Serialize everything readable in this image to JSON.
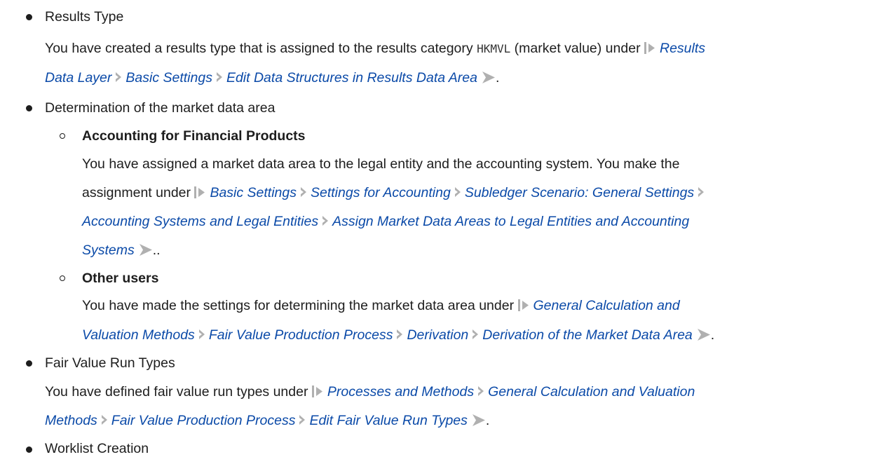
{
  "items": {
    "results_type": {
      "title": "Results Type",
      "text_1": "You have created a results type that is assigned to the results category ",
      "code": "HKMVL",
      "text_2": " (market value) under ",
      "path": [
        "Results",
        "Data Layer",
        "Basic Settings",
        "Edit Data Structures in Results Data Area"
      ],
      "end": "."
    },
    "market_data_area": {
      "title": "Determination of the market data area",
      "accounting": {
        "title": "Accounting for Financial Products",
        "text_line1": "You have assigned a market data area to the legal entity and the accounting system. You make the",
        "text_line2": "assignment under ",
        "path": [
          "Basic Settings",
          "Settings for Accounting",
          "Subledger Scenario: General Settings",
          "Accounting Systems and Legal Entities",
          "Assign Market Data Areas to Legal Entities and Accounting",
          "Systems"
        ],
        "end": ".."
      },
      "other_users": {
        "title": "Other users",
        "text": "You have made the settings for determining the market data area under ",
        "path": [
          "General Calculation and",
          "Valuation Methods",
          "Fair Value Production Process",
          "Derivation",
          "Derivation of the Market Data Area"
        ],
        "end": "."
      }
    },
    "run_types": {
      "title": "Fair Value Run Types",
      "text": "You have defined fair value run types under ",
      "path": [
        "Processes and Methods",
        "General Calculation and Valuation",
        "Methods",
        "Fair Value Production Process",
        "Edit Fair Value Run Types"
      ],
      "end": "."
    },
    "worklist": {
      "title": "Worklist Creation"
    }
  }
}
